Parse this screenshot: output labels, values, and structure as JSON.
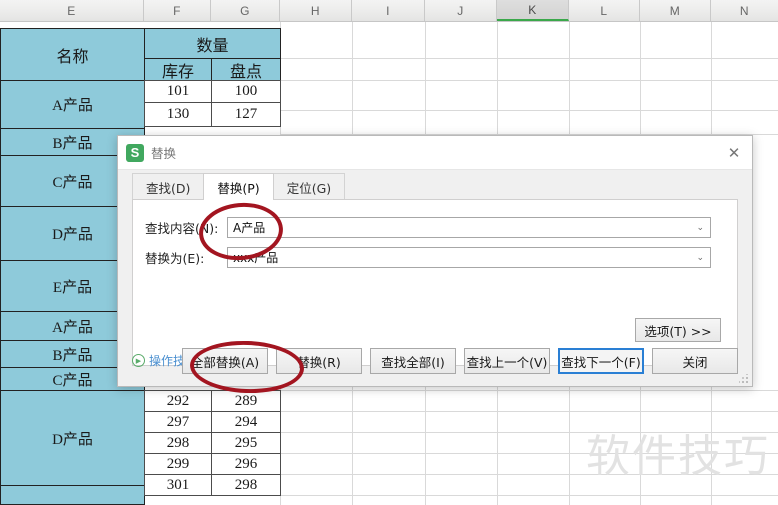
{
  "spreadsheet": {
    "column_headers": [
      "E",
      "F",
      "G",
      "H",
      "I",
      "J",
      "K",
      "L",
      "M",
      "N"
    ],
    "selected_column": "K",
    "header": {
      "name_label": "名称",
      "quantity_label": "数量",
      "stock_label": "库存",
      "count_label": "盘点"
    },
    "products": [
      "A产品",
      "B产品",
      "C产品",
      "D产品",
      "E产品",
      "A产品",
      "B产品",
      "C产品",
      "D产品"
    ],
    "numbers_top": [
      {
        "stock": "101",
        "count": "100"
      },
      {
        "stock": "130",
        "count": "127"
      }
    ],
    "numbers_bottom": [
      {
        "stock": "292",
        "count": "289"
      },
      {
        "stock": "297",
        "count": "294"
      },
      {
        "stock": "298",
        "count": "295"
      },
      {
        "stock": "299",
        "count": "296"
      },
      {
        "stock": "301",
        "count": "298"
      }
    ],
    "watermark": "软件技巧",
    "cell_fill_color": "#8ecada",
    "selection_accent_color": "#3aa84a"
  },
  "dialog": {
    "title": "替换",
    "logo_text": "S",
    "close_icon": "✕",
    "tabs": [
      {
        "label": "查找(D)",
        "active": false
      },
      {
        "label": "替换(P)",
        "active": true
      },
      {
        "label": "定位(G)",
        "active": false
      }
    ],
    "fields": {
      "find_label": "查找内容(N):",
      "find_value": "A产品",
      "replace_label": "替换为(E):",
      "replace_value": "xxx产品",
      "dropdown_icon": "⌄"
    },
    "options_button": "选项(T) >>",
    "tip_link": "操作技巧",
    "tip_icon": "▶",
    "buttons": [
      {
        "label": "全部替换(A)",
        "focused": false
      },
      {
        "label": "替换(R)",
        "focused": false
      },
      {
        "label": "查找全部(I)",
        "focused": false
      },
      {
        "label": "查找上一个(V)",
        "focused": false
      },
      {
        "label": "查找下一个(F)",
        "focused": true
      },
      {
        "label": "关闭",
        "focused": false
      }
    ],
    "annotation_color": "#a31520"
  }
}
